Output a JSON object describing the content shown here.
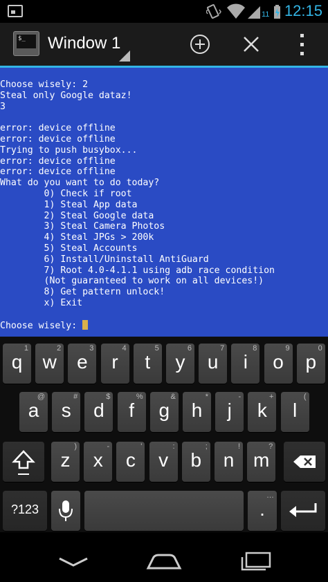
{
  "status_bar": {
    "time": "12:15",
    "signal_badge": "11",
    "icons": [
      "notification-icon",
      "vibrate-icon",
      "wifi-icon",
      "signal-icon",
      "battery-icon"
    ]
  },
  "action_bar": {
    "title": "Window 1",
    "buttons": [
      "add-window",
      "close-window",
      "overflow-menu"
    ]
  },
  "terminal": {
    "lines": [
      "Choose wisely: 2",
      "Steal only Google dataz!",
      "3",
      "",
      "error: device offline",
      "error: device offline",
      "Trying to push busybox...",
      "error: device offline",
      "error: device offline",
      "What do you want to do today?",
      "        0) Check if root",
      "        1) Steal App data",
      "        2) Steal Google data",
      "        3) Steal Camera Photos",
      "        4) Steal JPGs > 200k",
      "        5) Steal Accounts",
      "        6) Install/Uninstall AntiGuard",
      "        7) Root 4.0-4.1.1 using adb race condition",
      "        (Not guaranteed to work on all devices!)",
      "        8) Get pattern unlock!",
      "        x) Exit",
      ""
    ],
    "prompt": "Choose wisely: "
  },
  "keyboard": {
    "row1": [
      {
        "k": "q",
        "h": "1"
      },
      {
        "k": "w",
        "h": "2"
      },
      {
        "k": "e",
        "h": "3"
      },
      {
        "k": "r",
        "h": "4"
      },
      {
        "k": "t",
        "h": "5"
      },
      {
        "k": "y",
        "h": "6"
      },
      {
        "k": "u",
        "h": "7"
      },
      {
        "k": "i",
        "h": "8"
      },
      {
        "k": "o",
        "h": "9"
      },
      {
        "k": "p",
        "h": "0"
      }
    ],
    "row2": [
      {
        "k": "a",
        "h": "@"
      },
      {
        "k": "s",
        "h": "#"
      },
      {
        "k": "d",
        "h": "$"
      },
      {
        "k": "f",
        "h": "%"
      },
      {
        "k": "g",
        "h": "&"
      },
      {
        "k": "h",
        "h": "*"
      },
      {
        "k": "j",
        "h": "-"
      },
      {
        "k": "k",
        "h": "+"
      },
      {
        "k": "l",
        "h": "("
      }
    ],
    "row3": [
      {
        "k": "z",
        "h": ")"
      },
      {
        "k": "x",
        "h": "-"
      },
      {
        "k": "c",
        "h": "'"
      },
      {
        "k": "v",
        "h": ":"
      },
      {
        "k": "b",
        "h": ";"
      },
      {
        "k": "n",
        "h": "!"
      },
      {
        "k": "m",
        "h": "?"
      }
    ],
    "symbols_label": "?123",
    "period_label": ".",
    "period_hint": "…"
  },
  "nav_bar": {
    "buttons": [
      "back-button",
      "home-button",
      "recents-button"
    ]
  }
}
